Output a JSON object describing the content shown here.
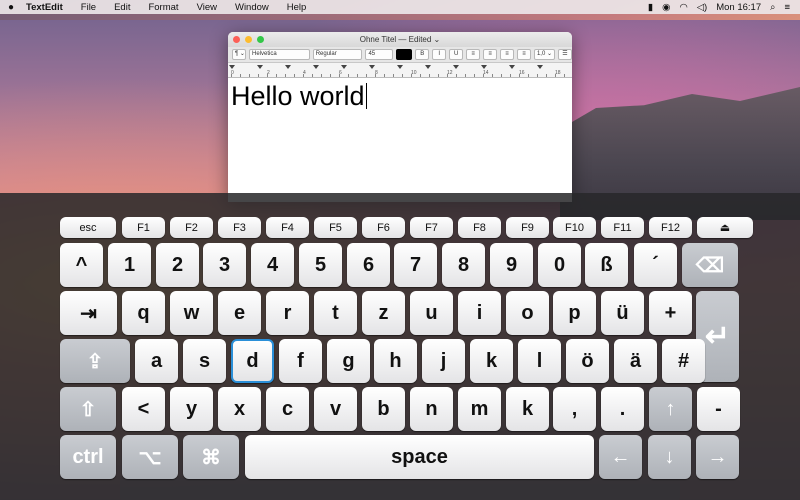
{
  "menubar": {
    "apple": "",
    "items": [
      "TextEdit",
      "File",
      "Edit",
      "Format",
      "View",
      "Window",
      "Help"
    ],
    "clock": "Mon 16:17"
  },
  "window": {
    "title": "Ohne Titel — Edited ⌄",
    "toolbar": {
      "paragraph_style": "¶ ⌄",
      "font_family": "Helvetica",
      "font_style": "Regular",
      "font_size": "45",
      "bold": "B",
      "italic": "I",
      "underline": "U",
      "line_spacing": "1,0 ⌄"
    },
    "ruler_numbers": [
      "0",
      "2",
      "4",
      "6",
      "8",
      "10",
      "12",
      "14",
      "16",
      "18"
    ],
    "document_text": "Hello world"
  },
  "keyboard": {
    "fn_row": [
      "esc",
      "F1",
      "F2",
      "F3",
      "F4",
      "F5",
      "F6",
      "F7",
      "F8",
      "F9",
      "F10",
      "F11",
      "F12",
      "⏏"
    ],
    "number_row": [
      "^",
      "1",
      "2",
      "3",
      "4",
      "5",
      "6",
      "7",
      "8",
      "9",
      "0",
      "ß",
      "´",
      "⌫"
    ],
    "top_row": [
      "⇥",
      "q",
      "w",
      "e",
      "r",
      "t",
      "z",
      "u",
      "i",
      "o",
      "p",
      "ü",
      "+",
      "↵"
    ],
    "home_row": [
      "⇪",
      "a",
      "s",
      "d",
      "f",
      "g",
      "h",
      "j",
      "k",
      "l",
      "ö",
      "ä",
      "#"
    ],
    "bottom_row": [
      "⇧",
      "<",
      "y",
      "x",
      "c",
      "v",
      "b",
      "n",
      "m",
      "k",
      ",",
      ".",
      "↑",
      "-"
    ],
    "mod_row": [
      "ctrl",
      "⌥",
      "⌘",
      "space",
      "←",
      "↓",
      "→"
    ],
    "selected_key": "d"
  }
}
